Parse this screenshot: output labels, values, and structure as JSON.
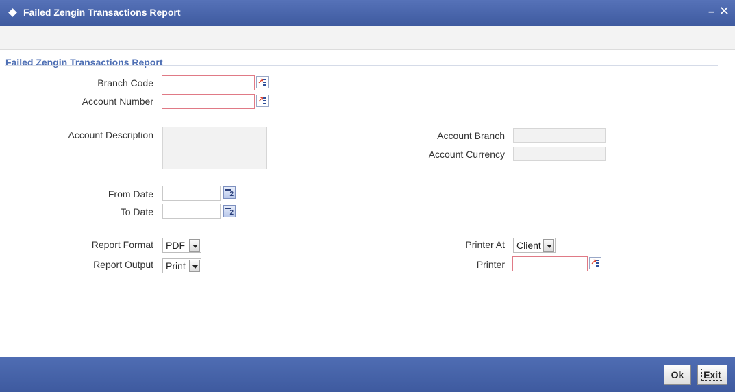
{
  "window": {
    "title": "Failed Zengin Transactions Report",
    "minimize": "–",
    "close": "✕"
  },
  "section": {
    "title": "Failed Zengin Transactions Report"
  },
  "form": {
    "branch_code_label": "Branch Code",
    "branch_code_value": "",
    "account_number_label": "Account Number",
    "account_number_value": "",
    "account_description_label": "Account Description",
    "account_description_value": "",
    "account_branch_label": "Account Branch",
    "account_branch_value": "",
    "account_currency_label": "Account Currency",
    "account_currency_value": "",
    "from_date_label": "From Date",
    "from_date_value": "",
    "to_date_label": "To Date",
    "to_date_value": "",
    "calendar_badge": "2",
    "report_format_label": "Report Format",
    "report_format_value": "PDF",
    "report_output_label": "Report Output",
    "report_output_value": "Print",
    "printer_at_label": "Printer At",
    "printer_at_value": "Client",
    "printer_label": "Printer",
    "printer_value": ""
  },
  "buttons": {
    "ok": "Ok",
    "exit": "Exit"
  },
  "colors": {
    "titlebar": "#4a67ad",
    "section_title": "#4e6fb4",
    "mandatory_border": "#e07a86"
  },
  "icons": {
    "lov": "list-of-values-icon",
    "calendar": "calendar-icon",
    "dropdown": "chevron-down-icon"
  }
}
